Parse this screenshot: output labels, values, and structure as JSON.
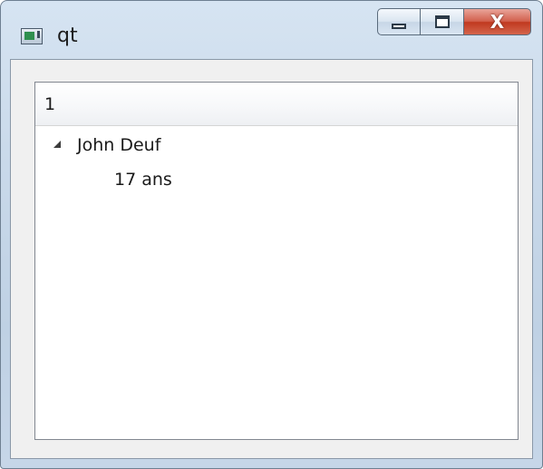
{
  "window": {
    "title": "qt",
    "icon": "app-window-icon",
    "caption": {
      "minimize_icon": "minimize-icon",
      "maximize_icon": "maximize-icon",
      "close_label": "X"
    }
  },
  "tree": {
    "header": {
      "column_label": "1"
    },
    "items": [
      {
        "label": "John Deuf",
        "expanded": true,
        "children": [
          {
            "label": "17 ans"
          }
        ]
      }
    ]
  },
  "colors": {
    "frame": "#c9d9ea",
    "close_button": "#c0391f",
    "client_background": "#f0f0f0",
    "tree_background": "#ffffff"
  }
}
